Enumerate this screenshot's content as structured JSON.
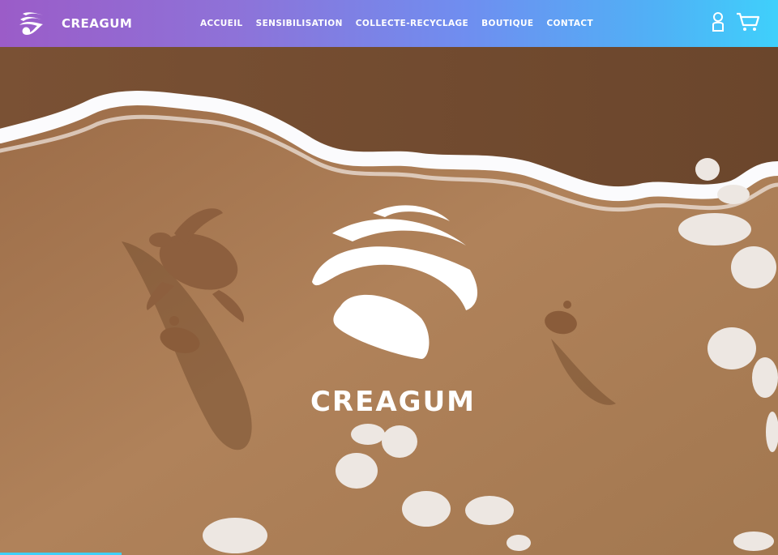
{
  "brand": {
    "name": "CREAGUM",
    "logo_icon": "creagum-wave-logo"
  },
  "nav": {
    "links": [
      {
        "label": "ACCUEIL"
      },
      {
        "label": "SENSIBILISATION"
      },
      {
        "label": "COLLECTE-RECYCLAGE"
      },
      {
        "label": "BOUTIQUE"
      },
      {
        "label": "CONTACT"
      }
    ],
    "icons": {
      "account": "user-icon",
      "cart": "cart-icon"
    }
  },
  "hero": {
    "title": "CREAGUM",
    "logo_icon": "creagum-wave-logo",
    "image": "beach-sea-turtles-photo"
  },
  "colors": {
    "nav_gradient_start": "#9b5cc8",
    "nav_gradient_end": "#3fd0fb",
    "sand": "#a97a52",
    "wet_sand": "#6e4a30",
    "foam": "#ffffff"
  }
}
